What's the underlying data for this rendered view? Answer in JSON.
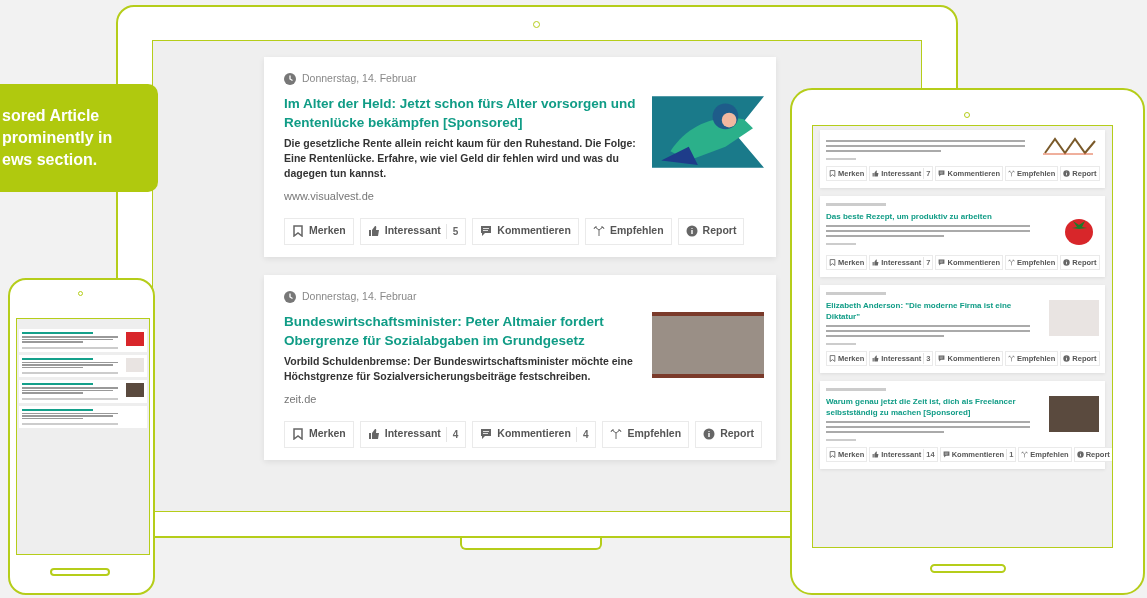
{
  "callout": {
    "lines": [
      "sored Article",
      "prominently in",
      "ews section."
    ]
  },
  "laptop": {
    "articles": [
      {
        "date": "Donnerstag, 14. Februar",
        "title": "Im Alter der Held: Jetzt schon fürs Alter vorsorgen und Rentenlücke bekämpfen [Sponsored]",
        "teaser": "Die gesetzliche Rente allein reicht kaum für den Ruhestand. Die Folge: Eine Rentenlücke. Erfahre, wie viel Geld dir fehlen wird und was du dagegen tun kannst.",
        "source": "www.visualvest.de",
        "actions": [
          {
            "kind": "bookmark",
            "label": "Merken"
          },
          {
            "kind": "like",
            "label": "Interessant",
            "count": "5"
          },
          {
            "kind": "comment",
            "label": "Kommentieren"
          },
          {
            "kind": "recommend",
            "label": "Empfehlen"
          },
          {
            "kind": "report",
            "label": "Report"
          }
        ]
      },
      {
        "date": "Donnerstag, 14. Februar",
        "title": "Bundeswirtschaftsminister: Peter Altmaier fordert Obergrenze für Sozialabgaben im Grundgesetz",
        "teaser": "Vorbild Schuldenbremse: Der Bundeswirtschaftsminister möchte eine Höchstgrenze für Sozialversicherungsbeiträge festschreiben.",
        "source": "zeit.de",
        "actions": [
          {
            "kind": "bookmark",
            "label": "Merken"
          },
          {
            "kind": "like",
            "label": "Interessant",
            "count": "4"
          },
          {
            "kind": "comment",
            "label": "Kommentieren",
            "count": "4"
          },
          {
            "kind": "recommend",
            "label": "Empfehlen"
          },
          {
            "kind": "report",
            "label": "Report"
          }
        ]
      }
    ]
  },
  "tablet": {
    "articles": [
      {
        "actions": [
          {
            "kind": "bookmark",
            "label": "Merken"
          },
          {
            "kind": "like",
            "label": "Interessant",
            "count": "7"
          },
          {
            "kind": "comment",
            "label": "Kommentieren"
          },
          {
            "kind": "recommend",
            "label": "Empfehlen"
          },
          {
            "kind": "report",
            "label": "Report"
          }
        ]
      },
      {
        "title": "Das beste Rezept, um produktiv zu arbeiten",
        "actions": [
          {
            "kind": "bookmark",
            "label": "Merken"
          },
          {
            "kind": "like",
            "label": "Interessant",
            "count": "7"
          },
          {
            "kind": "comment",
            "label": "Kommentieren"
          },
          {
            "kind": "recommend",
            "label": "Empfehlen"
          },
          {
            "kind": "report",
            "label": "Report"
          }
        ]
      },
      {
        "title": "Elizabeth Anderson: \"Die moderne Firma ist eine Diktatur\"",
        "actions": [
          {
            "kind": "bookmark",
            "label": "Merken"
          },
          {
            "kind": "like",
            "label": "Interessant",
            "count": "3"
          },
          {
            "kind": "comment",
            "label": "Kommentieren"
          },
          {
            "kind": "recommend",
            "label": "Empfehlen"
          },
          {
            "kind": "report",
            "label": "Report"
          }
        ]
      },
      {
        "title": "Warum genau jetzt die Zeit ist, dich als Freelancer selbstständig zu machen [Sponsored]",
        "actions": [
          {
            "kind": "bookmark",
            "label": "Merken"
          },
          {
            "kind": "like",
            "label": "Interessant",
            "count": "14"
          },
          {
            "kind": "comment",
            "label": "Kommentieren",
            "count": "1"
          },
          {
            "kind": "recommend",
            "label": "Empfehlen"
          },
          {
            "kind": "report",
            "label": "Report"
          }
        ]
      }
    ]
  }
}
